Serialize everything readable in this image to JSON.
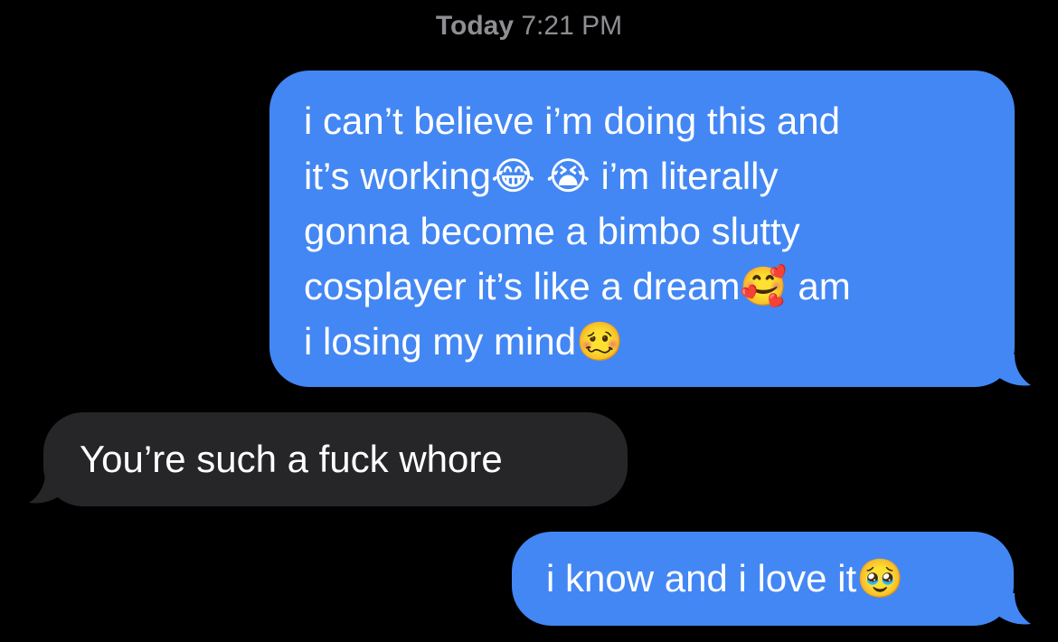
{
  "header": {
    "day": "Today",
    "time": "7:21 PM"
  },
  "colors": {
    "background": "#000000",
    "sent_bubble": "#4387f4",
    "received_bubble": "#262628",
    "timestamp": "#8e8e93",
    "message_text": "#ffffff"
  },
  "messages": [
    {
      "direction": "sent",
      "text": "i can’t believe i’m doing this and\nit’s working😂 😭 i’m literally\ngonna become a bimbo slutty\ncosplayer it’s like a dream🥰 am\ni losing my mind🥴",
      "emojis": [
        "face-with-tears-of-joy-icon",
        "loudly-crying-face-icon",
        "smiling-face-with-hearts-icon",
        "woozy-face-icon"
      ]
    },
    {
      "direction": "received",
      "text": "You’re such a fuck whore"
    },
    {
      "direction": "sent",
      "text": "i know and i love it🥹",
      "emojis": [
        "face-holding-back-tears-icon"
      ]
    }
  ]
}
